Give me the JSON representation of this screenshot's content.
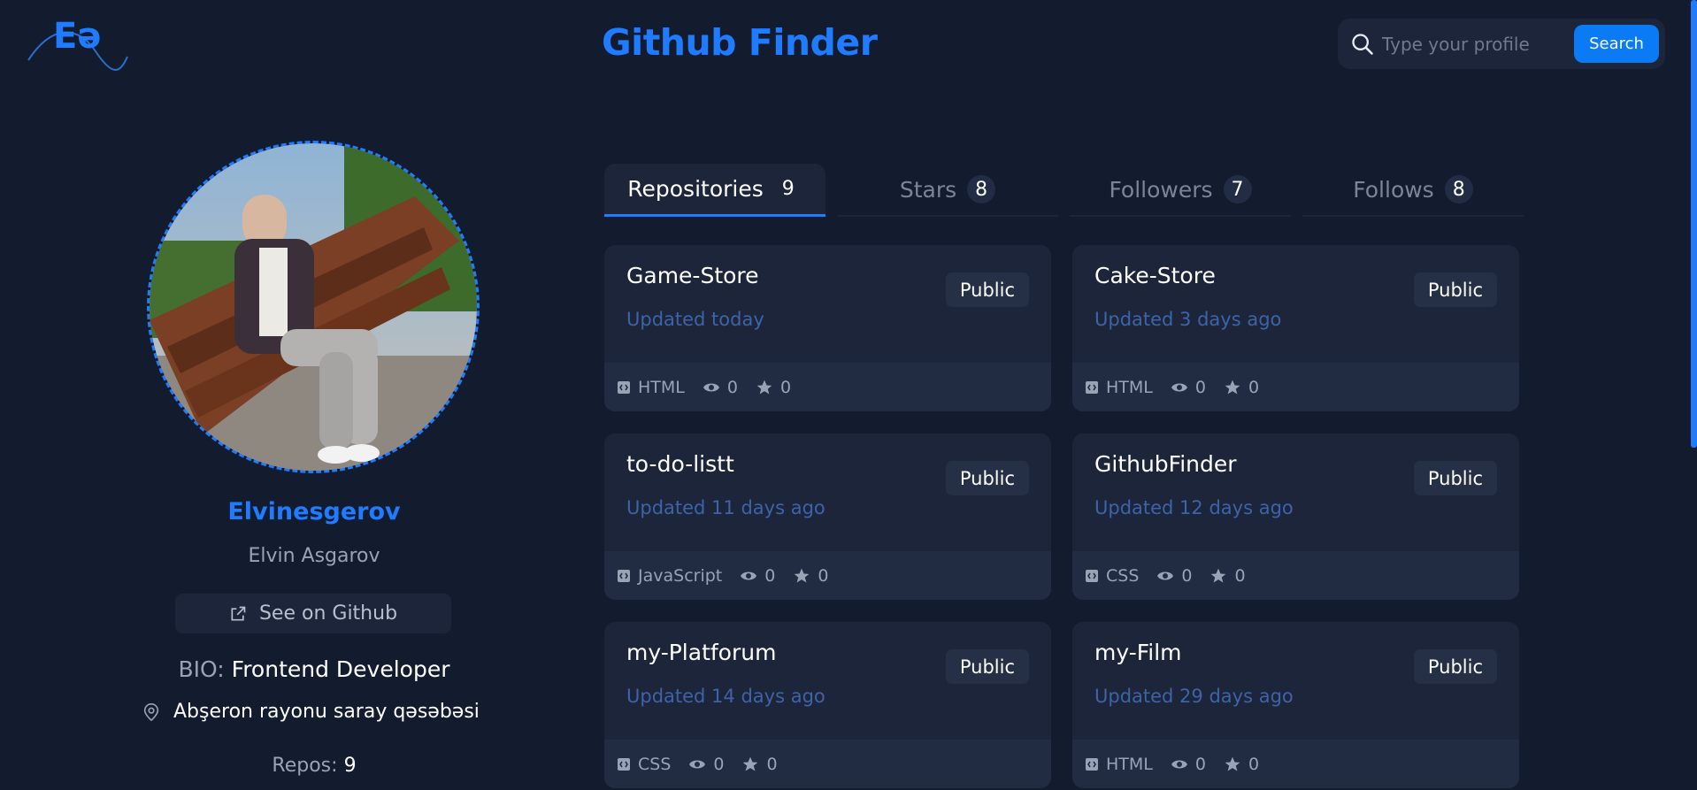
{
  "app": {
    "logo_text": "Eə",
    "title": "Github Finder"
  },
  "search": {
    "placeholder": "Type your profile",
    "button_label": "Search"
  },
  "profile": {
    "login": "Elvinesgerov",
    "name": "Elvin Asgarov",
    "github_link_label": "See on Github",
    "bio_label": "BIO:",
    "bio": "Frontend Developer",
    "location": "Abşeron rayonu saray qəsəbəsi",
    "repos_label": "Repos:",
    "repos": "9"
  },
  "tabs": [
    {
      "label": "Repositories",
      "count": "9",
      "active": true
    },
    {
      "label": "Stars",
      "count": "8",
      "active": false
    },
    {
      "label": "Followers",
      "count": "7",
      "active": false
    },
    {
      "label": "Follows",
      "count": "8",
      "active": false
    }
  ],
  "repos": [
    {
      "name": "Game-Store",
      "visibility": "Public",
      "updated": "Updated today",
      "language": "HTML",
      "watchers": "0",
      "stars": "0"
    },
    {
      "name": "Cake-Store",
      "visibility": "Public",
      "updated": "Updated 3 days ago",
      "language": "HTML",
      "watchers": "0",
      "stars": "0"
    },
    {
      "name": "to-do-listt",
      "visibility": "Public",
      "updated": "Updated 11 days ago",
      "language": "JavaScript",
      "watchers": "0",
      "stars": "0"
    },
    {
      "name": "GithubFinder",
      "visibility": "Public",
      "updated": "Updated 12 days ago",
      "language": "CSS",
      "watchers": "0",
      "stars": "0"
    },
    {
      "name": "my-Platforum",
      "visibility": "Public",
      "updated": "Updated 14 days ago",
      "language": "CSS",
      "watchers": "0",
      "stars": "0"
    },
    {
      "name": "my-Film",
      "visibility": "Public",
      "updated": "Updated 29 days ago",
      "language": "HTML",
      "watchers": "0",
      "stars": "0"
    }
  ],
  "colors": {
    "background": "#131b2e",
    "card": "#1c2539",
    "accent": "#1f7bff",
    "updated_text": "#3d63a8"
  }
}
